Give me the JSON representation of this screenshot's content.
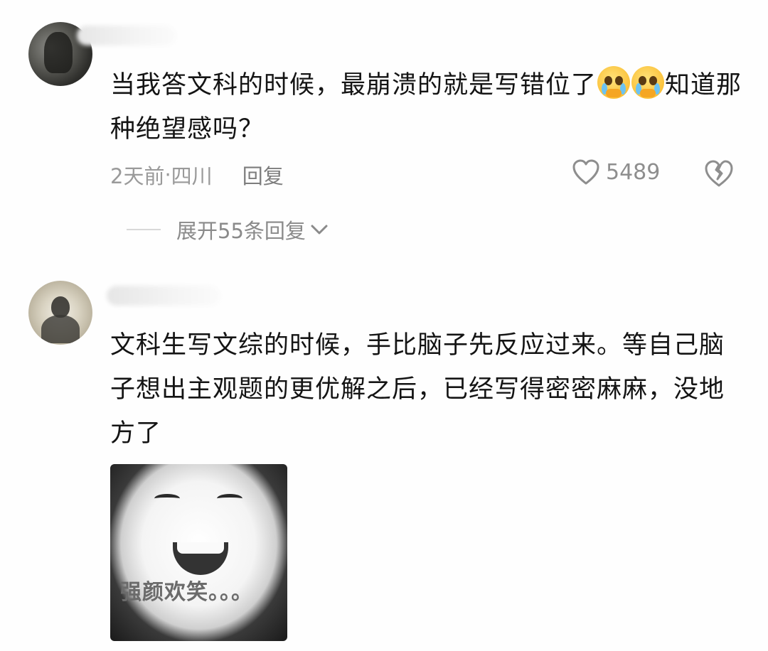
{
  "comments": [
    {
      "text_part1": "当我答文科的时候，最崩溃的就是写错位了",
      "emoji_name": "crying-face-emoji",
      "text_part2": "知道那种绝望感吗？",
      "time": "2天前",
      "separator": " · ",
      "location": "四川",
      "reply_label": "回复",
      "likes": "5489",
      "expand_label": "展开55条回复"
    },
    {
      "text": "文科生写文综的时候，手比脑子先反应过来。等自己脑子想出主观题的更优解之后，已经写得密密麻麻，没地方了",
      "image_caption": "强颜欢笑。。。"
    }
  ],
  "icons": {
    "like": "heart-outline-icon",
    "dislike": "broken-heart-icon",
    "expand": "chevron-down-icon"
  },
  "colors": {
    "meta_text": "#9a9a9a",
    "body_text": "#141414",
    "emoji_yellow": "#fbc23b"
  }
}
